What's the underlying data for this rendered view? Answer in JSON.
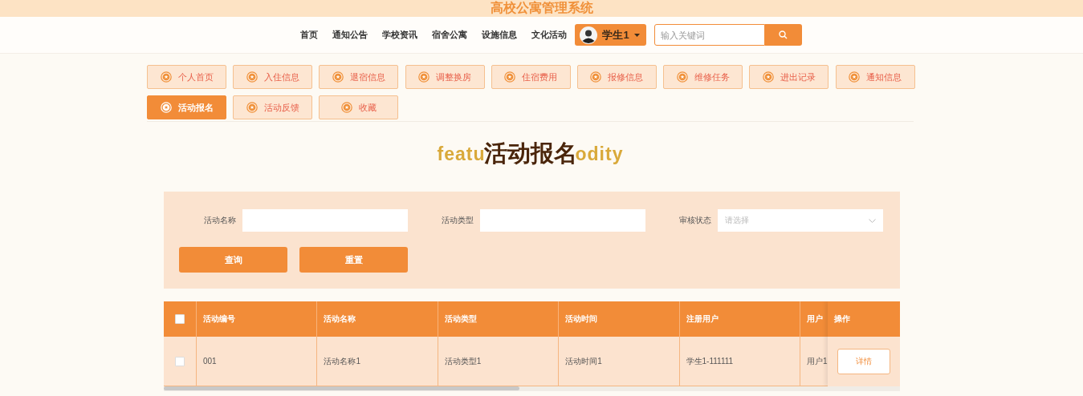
{
  "header": {
    "title": "高校公寓管理系统"
  },
  "nav": {
    "items": [
      {
        "label": "首页"
      },
      {
        "label": "通知公告"
      },
      {
        "label": "学校资讯"
      },
      {
        "label": "宿舍公寓"
      },
      {
        "label": "设施信息"
      },
      {
        "label": "文化活动"
      }
    ],
    "user": {
      "name": "学生1"
    },
    "search": {
      "placeholder": "输入关键词"
    }
  },
  "tabs": [
    {
      "label": "个人首页",
      "selected": false
    },
    {
      "label": "入住信息",
      "selected": false
    },
    {
      "label": "退宿信息",
      "selected": false
    },
    {
      "label": "调整换房",
      "selected": false
    },
    {
      "label": "住宿费用",
      "selected": false
    },
    {
      "label": "报修信息",
      "selected": false
    },
    {
      "label": "维修任务",
      "selected": false
    },
    {
      "label": "进出记录",
      "selected": false
    },
    {
      "label": "通知信息",
      "selected": false
    },
    {
      "label": "活动报名",
      "selected": true
    },
    {
      "label": "活动反馈",
      "selected": false
    },
    {
      "label": "收藏",
      "selected": false
    }
  ],
  "page": {
    "title": "活动报名",
    "subtitle_left": "featu",
    "subtitle_right": "odity"
  },
  "filters": {
    "fields": [
      {
        "kind": "text",
        "label": "活动名称"
      },
      {
        "kind": "text",
        "label": "活动类型"
      },
      {
        "kind": "select",
        "label": "审核状态",
        "placeholder": "请选择"
      }
    ],
    "buttons": [
      "查询",
      "重置"
    ]
  },
  "table": {
    "header_checked": false,
    "columns": [
      "活动编号",
      "活动名称",
      "活动类型",
      "活动时间",
      "注册用户",
      "用户"
    ],
    "action_column": "操作",
    "rows": [
      {
        "checked": false,
        "cells": [
          "001",
          "活动名称1",
          "活动类型1",
          "活动时间1",
          "学生1-111111",
          "用户1"
        ],
        "action": "详情"
      }
    ]
  }
}
